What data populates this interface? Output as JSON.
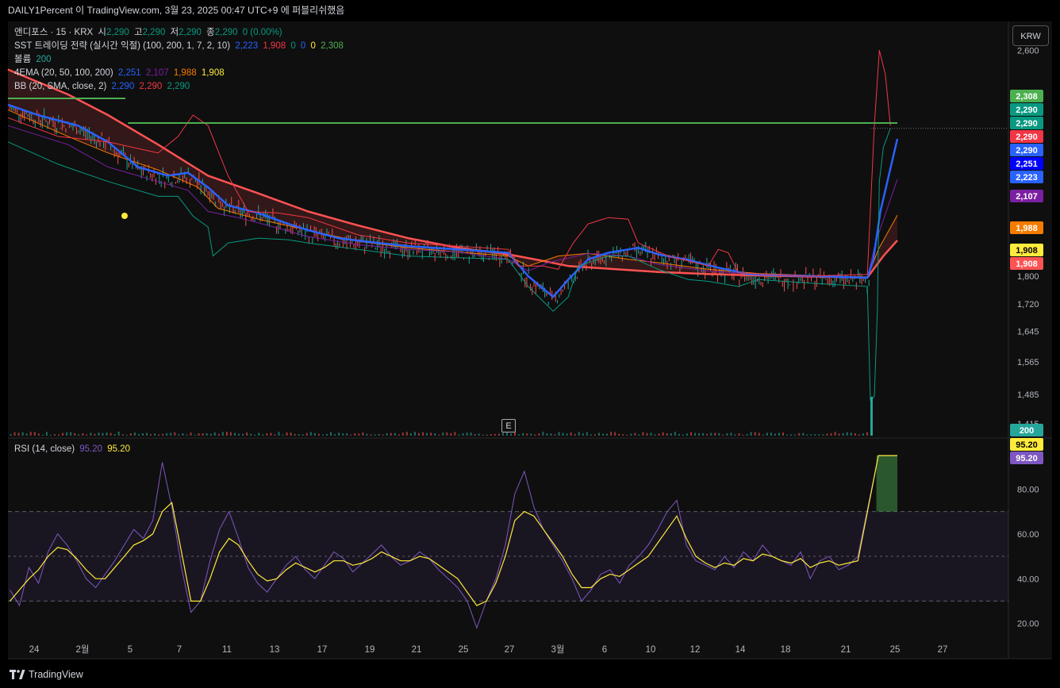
{
  "header": {
    "publisher": "DAILY1Percent 이 TradingView.com, 3월 23, 2025 00:47 UTC+9 에 퍼블리쉬했음"
  },
  "currency_button": "KRW",
  "earnings_badge": "E",
  "footer": {
    "brand": "TradingView"
  },
  "legend": {
    "symbol": {
      "name": "앤디포스 · 15 · KRX",
      "o_label": "시",
      "o": "2,290",
      "h_label": "고",
      "h": "2,290",
      "l_label": "저",
      "l": "2,290",
      "c_label": "종",
      "c": "2,290",
      "chg": "0 (0.00%)"
    },
    "sst": {
      "label": "SST 트레이딩 전략 (실시간 익절) (100, 200, 1, 7, 2, 10)",
      "v1": "2,223",
      "v2": "1,908",
      "v3": "0",
      "v4": "0",
      "v5": "0",
      "v6": "2,308"
    },
    "volume": {
      "label": "볼륨",
      "value": "200"
    },
    "ema": {
      "label": "4EMA (20, 50, 100, 200)",
      "v20": "2,251",
      "v50": "2,107",
      "v100": "1,988",
      "v200": "1,908"
    },
    "bb": {
      "label": "BB (20, SMA, close, 2)",
      "basis": "2,290",
      "upper": "2,290",
      "lower": "2,290"
    },
    "rsi": {
      "label": "RSI (14, close)",
      "rsi": "95.20",
      "ma": "95.20"
    }
  },
  "colors": {
    "background": "#0f0f0f",
    "ema20": "#2962ff",
    "ema50": "#7b1fa2",
    "ema100": "#f57c00",
    "ema200": "#ff5252",
    "bb_upper": "#f23645",
    "bb_lower": "#089981",
    "bb_basis": "#2962ff",
    "resistance": "#4caf50",
    "rsi_line": "#7e57c2",
    "rsi_ma": "#ffeb3b",
    "up": "#26a69a",
    "down": "#ef5350"
  },
  "chart_data": [
    {
      "type": "line",
      "panel": "price",
      "x_ticks": [
        "24",
        "2월",
        "5",
        "7",
        "11",
        "13",
        "17",
        "19",
        "21",
        "25",
        "27",
        "3월",
        "6",
        "10",
        "12",
        "14",
        "18",
        "21",
        "25",
        "27"
      ],
      "y_ticks": [
        2600,
        1800,
        1720,
        1645,
        1565,
        1485,
        1415
      ],
      "y_scale": "log",
      "ylim": [
        1390,
        2680
      ],
      "series": [
        {
          "name": "4EMA 200",
          "points": [
            [
              0,
              2520
            ],
            [
              0.06,
              2420
            ],
            [
              0.1,
              2340
            ],
            [
              0.15,
              2230
            ],
            [
              0.2,
              2120
            ],
            [
              0.25,
              2060
            ],
            [
              0.3,
              2000
            ],
            [
              0.35,
              1955
            ],
            [
              0.4,
              1915
            ],
            [
              0.45,
              1885
            ],
            [
              0.5,
              1865
            ],
            [
              0.53,
              1848
            ],
            [
              0.56,
              1830
            ],
            [
              0.6,
              1822
            ],
            [
              0.65,
              1812
            ],
            [
              0.7,
              1806
            ],
            [
              0.75,
              1802
            ],
            [
              0.8,
              1799
            ],
            [
              0.859,
              1796
            ],
            [
              0.875,
              1860
            ],
            [
              0.889,
              1908
            ]
          ]
        },
        {
          "name": "4EMA 100",
          "points": [
            [
              0,
              2360
            ],
            [
              0.06,
              2260
            ],
            [
              0.1,
              2200
            ],
            [
              0.15,
              2140
            ],
            [
              0.19,
              2080
            ],
            [
              0.21,
              2010
            ],
            [
              0.25,
              1975
            ],
            [
              0.3,
              1940
            ],
            [
              0.35,
              1905
            ],
            [
              0.4,
              1885
            ],
            [
              0.45,
              1872
            ],
            [
              0.5,
              1860
            ],
            [
              0.52,
              1830
            ],
            [
              0.55,
              1860
            ],
            [
              0.58,
              1868
            ],
            [
              0.62,
              1850
            ],
            [
              0.65,
              1840
            ],
            [
              0.7,
              1820
            ],
            [
              0.75,
              1808
            ],
            [
              0.8,
              1802
            ],
            [
              0.859,
              1797
            ],
            [
              0.87,
              1880
            ],
            [
              0.889,
              1988
            ]
          ]
        },
        {
          "name": "4EMA 50",
          "points": [
            [
              0,
              2300
            ],
            [
              0.06,
              2230
            ],
            [
              0.1,
              2150
            ],
            [
              0.15,
              2100
            ],
            [
              0.18,
              2070
            ],
            [
              0.2,
              2000
            ],
            [
              0.23,
              1980
            ],
            [
              0.26,
              1955
            ],
            [
              0.3,
              1920
            ],
            [
              0.35,
              1895
            ],
            [
              0.4,
              1880
            ],
            [
              0.45,
              1872
            ],
            [
              0.5,
              1850
            ],
            [
              0.52,
              1815
            ],
            [
              0.54,
              1840
            ],
            [
              0.58,
              1868
            ],
            [
              0.62,
              1860
            ],
            [
              0.65,
              1835
            ],
            [
              0.7,
              1815
            ],
            [
              0.75,
              1805
            ],
            [
              0.8,
              1800
            ],
            [
              0.859,
              1795
            ],
            [
              0.867,
              1900
            ],
            [
              0.889,
              2107
            ]
          ]
        },
        {
          "name": "4EMA 20",
          "points": [
            [
              0,
              2380
            ],
            [
              0.03,
              2340
            ],
            [
              0.07,
              2300
            ],
            [
              0.1,
              2240
            ],
            [
              0.13,
              2150
            ],
            [
              0.16,
              2120
            ],
            [
              0.18,
              2130
            ],
            [
              0.2,
              2080
            ],
            [
              0.22,
              2020
            ],
            [
              0.25,
              1995
            ],
            [
              0.28,
              1960
            ],
            [
              0.3,
              1940
            ],
            [
              0.33,
              1915
            ],
            [
              0.37,
              1900
            ],
            [
              0.4,
              1890
            ],
            [
              0.45,
              1880
            ],
            [
              0.5,
              1870
            ],
            [
              0.52,
              1800
            ],
            [
              0.545,
              1740
            ],
            [
              0.56,
              1790
            ],
            [
              0.58,
              1850
            ],
            [
              0.6,
              1870
            ],
            [
              0.63,
              1885
            ],
            [
              0.65,
              1865
            ],
            [
              0.68,
              1848
            ],
            [
              0.71,
              1825
            ],
            [
              0.74,
              1806
            ],
            [
              0.78,
              1802
            ],
            [
              0.82,
              1799
            ],
            [
              0.859,
              1795
            ],
            [
              0.865,
              1850
            ],
            [
              0.872,
              2000
            ],
            [
              0.889,
              2251
            ]
          ]
        },
        {
          "name": "BB upper",
          "points": [
            [
              0,
              2330
            ],
            [
              0.05,
              2260
            ],
            [
              0.1,
              2240
            ],
            [
              0.15,
              2200
            ],
            [
              0.17,
              2260
            ],
            [
              0.185,
              2340
            ],
            [
              0.2,
              2300
            ],
            [
              0.22,
              2120
            ],
            [
              0.24,
              2000
            ],
            [
              0.27,
              1995
            ],
            [
              0.3,
              1980
            ],
            [
              0.35,
              1925
            ],
            [
              0.4,
              1900
            ],
            [
              0.45,
              1890
            ],
            [
              0.5,
              1880
            ],
            [
              0.51,
              1830
            ],
            [
              0.535,
              1830
            ],
            [
              0.55,
              1820
            ],
            [
              0.565,
              1900
            ],
            [
              0.58,
              1960
            ],
            [
              0.6,
              1980
            ],
            [
              0.62,
              1975
            ],
            [
              0.63,
              1900
            ],
            [
              0.66,
              1860
            ],
            [
              0.7,
              1830
            ],
            [
              0.71,
              1880
            ],
            [
              0.72,
              1870
            ],
            [
              0.73,
              1810
            ],
            [
              0.76,
              1805
            ],
            [
              0.8,
              1800
            ],
            [
              0.859,
              1805
            ],
            [
              0.866,
              2300
            ],
            [
              0.871,
              2600
            ],
            [
              0.877,
              2500
            ],
            [
              0.882,
              2300
            ]
          ]
        },
        {
          "name": "BB lower",
          "points": [
            [
              0,
              2240
            ],
            [
              0.05,
              2160
            ],
            [
              0.1,
              2100
            ],
            [
              0.15,
              2050
            ],
            [
              0.17,
              2050
            ],
            [
              0.185,
              1985
            ],
            [
              0.2,
              1950
            ],
            [
              0.205,
              1860
            ],
            [
              0.22,
              1900
            ],
            [
              0.25,
              1915
            ],
            [
              0.28,
              1910
            ],
            [
              0.3,
              1900
            ],
            [
              0.35,
              1880
            ],
            [
              0.4,
              1860
            ],
            [
              0.45,
              1855
            ],
            [
              0.5,
              1850
            ],
            [
              0.52,
              1770
            ],
            [
              0.545,
              1700
            ],
            [
              0.56,
              1740
            ],
            [
              0.57,
              1830
            ],
            [
              0.59,
              1850
            ],
            [
              0.6,
              1860
            ],
            [
              0.62,
              1860
            ],
            [
              0.65,
              1820
            ],
            [
              0.68,
              1790
            ],
            [
              0.7,
              1785
            ],
            [
              0.73,
              1770
            ],
            [
              0.75,
              1790
            ],
            [
              0.8,
              1780
            ],
            [
              0.859,
              1770
            ],
            [
              0.862,
              1470
            ],
            [
              0.866,
              1480
            ],
            [
              0.869,
              1700
            ],
            [
              0.871,
              2100
            ],
            [
              0.875,
              2220
            ],
            [
              0.882,
              2290
            ]
          ]
        },
        {
          "name": "Resistance",
          "points": [
            [
              0.12,
              2310
            ],
            [
              0.889,
              2310
            ]
          ]
        }
      ]
    },
    {
      "type": "line",
      "panel": "rsi",
      "y_ticks": [
        80,
        60,
        40,
        20
      ],
      "ylim": [
        5,
        100
      ],
      "bands": {
        "upper": 70,
        "middle": 50,
        "lower": 30
      },
      "series": [
        {
          "name": "RSI",
          "values": [
            35,
            28,
            45,
            38,
            52,
            60,
            55,
            48,
            40,
            36,
            42,
            48,
            55,
            62,
            58,
            66,
            92,
            72,
            45,
            25,
            30,
            48,
            62,
            70,
            58,
            45,
            38,
            34,
            40,
            46,
            50,
            44,
            40,
            46,
            52,
            49,
            43,
            47,
            51,
            55,
            50,
            46,
            48,
            52,
            49,
            44,
            40,
            36,
            30,
            18,
            30,
            40,
            55,
            78,
            88,
            72,
            62,
            55,
            48,
            40,
            30,
            35,
            42,
            44,
            38,
            46,
            50,
            55,
            62,
            70,
            75,
            55,
            48,
            46,
            44,
            50,
            45,
            52,
            48,
            55,
            50,
            48,
            46,
            52,
            40,
            48,
            50,
            44,
            46,
            50,
            95
          ]
        },
        {
          "name": "RSI MA",
          "values": [
            30,
            35,
            40,
            44,
            50,
            54,
            53,
            49,
            44,
            40,
            40,
            45,
            50,
            55,
            57,
            60,
            70,
            74,
            52,
            30,
            30,
            40,
            52,
            58,
            55,
            48,
            42,
            39,
            40,
            44,
            47,
            45,
            43,
            45,
            48,
            48,
            46,
            47,
            49,
            52,
            50,
            48,
            48,
            50,
            49,
            46,
            43,
            40,
            34,
            28,
            30,
            38,
            50,
            66,
            70,
            68,
            62,
            56,
            50,
            42,
            36,
            36,
            40,
            42,
            41,
            44,
            47,
            50,
            56,
            62,
            68,
            58,
            50,
            47,
            45,
            47,
            46,
            49,
            48,
            51,
            50,
            48,
            47,
            49,
            45,
            47,
            48,
            46,
            47,
            48,
            95
          ]
        }
      ]
    }
  ],
  "price_axis_labels": [
    {
      "text": "2,308",
      "color": "#4caf50",
      "value": 2308
    },
    {
      "text": "2,290",
      "color": "#089981",
      "value": 2290
    },
    {
      "text": "2,290",
      "color": "#089981",
      "value": 2290
    },
    {
      "text": "2,290",
      "color": "#f23645",
      "value": 2290
    },
    {
      "text": "2,290",
      "color": "#2962ff",
      "value": 2290
    },
    {
      "text": "2,251",
      "color": "#0000ff",
      "value": 2251
    },
    {
      "text": "2,223",
      "color": "#2962ff",
      "value": 2223
    },
    {
      "text": "2,107",
      "color": "#7b1fa2",
      "value": 2107
    },
    {
      "text": "1,988",
      "color": "#f57c00",
      "value": 1988
    },
    {
      "text": "1,908",
      "color": "#ffeb3b",
      "value": 1908
    },
    {
      "text": "1,908",
      "color": "#ff5252",
      "value": 1908
    },
    {
      "text": "200",
      "color": "#26a69a",
      "value": 0
    }
  ],
  "rsi_axis_labels": [
    {
      "text": "95.20",
      "color": "#ffeb3b"
    },
    {
      "text": "95.20",
      "color": "#7e57c2"
    }
  ]
}
